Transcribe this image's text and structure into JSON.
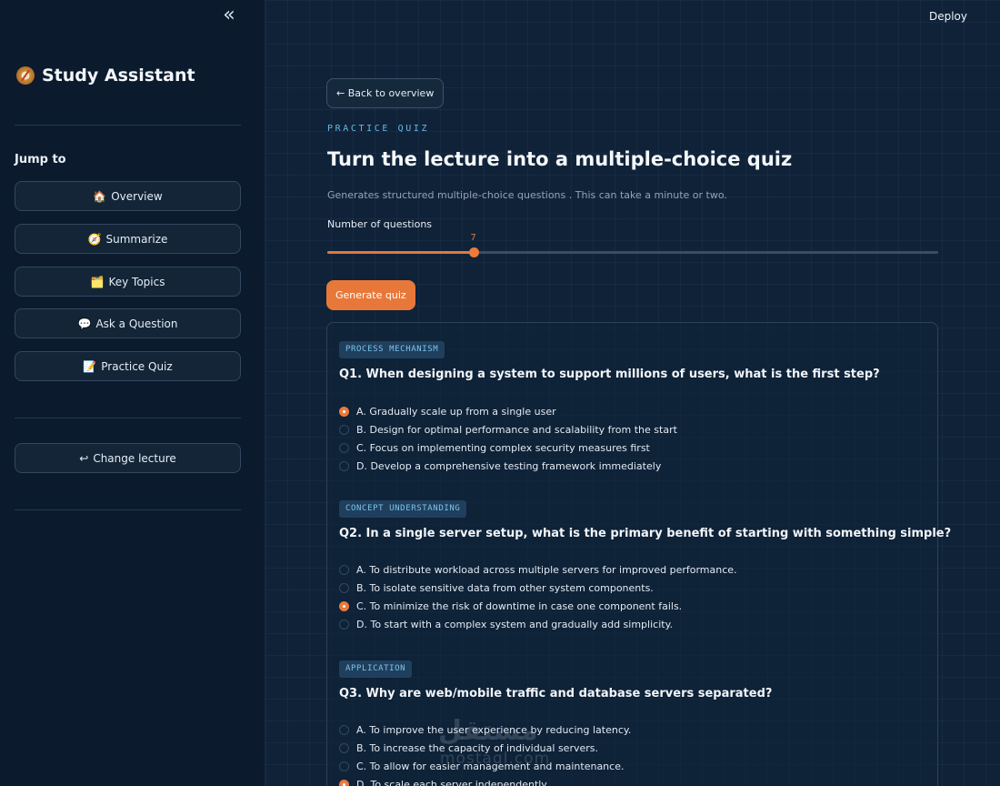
{
  "sidebar": {
    "title": "Study Assistant",
    "jump_label": "Jump to",
    "nav": [
      {
        "icon": "house-icon",
        "glyph": "🏠",
        "label": "Overview"
      },
      {
        "icon": "compass-icon",
        "glyph": "🧭",
        "label": "Summarize"
      },
      {
        "icon": "folder-icon",
        "glyph": "🗂️",
        "label": "Key Topics"
      },
      {
        "icon": "speech-bubble-icon",
        "glyph": "💬",
        "label": "Ask a Question"
      },
      {
        "icon": "memo-icon",
        "glyph": "📝",
        "label": "Practice Quiz"
      }
    ],
    "change_lecture": {
      "glyph": "↩",
      "label": "Change lecture"
    }
  },
  "header": {
    "deploy": "Deploy"
  },
  "main": {
    "back_label": "← Back to overview",
    "kicker": "PRACTICE QUIZ",
    "title": "Turn the lecture into a multiple-choice quiz",
    "subtitle": "Generates structured multiple-choice questions . This can take a minute or two.",
    "slider": {
      "label": "Number of questions",
      "value": 7,
      "fill_fraction": 0.239
    },
    "generate_label": "Generate quiz",
    "questions": [
      {
        "tag": "PROCESS MECHANISM",
        "text": "Q1. When designing a system to support millions of users, what is the first step?",
        "selected": 0,
        "options": [
          "A. Gradually scale up from a single user",
          "B. Design for optimal performance and scalability from the start",
          "C. Focus on implementing complex security measures first",
          "D. Develop a comprehensive testing framework immediately"
        ]
      },
      {
        "tag": "CONCEPT UNDERSTANDING",
        "text": "Q2. In a single server setup, what is the primary benefit of starting with something simple?",
        "selected": 2,
        "options": [
          "A. To distribute workload across multiple servers for improved performance.",
          "B. To isolate sensitive data from other system components.",
          "C. To minimize the risk of downtime in case one component fails.",
          "D. To start with a complex system and gradually add simplicity."
        ]
      },
      {
        "tag": "APPLICATION",
        "text": "Q3. Why are web/mobile traffic and database servers separated?",
        "selected": 3,
        "options": [
          "A. To improve the user experience by reducing latency.",
          "B. To increase the capacity of individual servers.",
          "C. To allow for easier management and maintenance.",
          "D. To scale each server independently"
        ]
      }
    ]
  },
  "watermark": {
    "text": "مستقل",
    "sub": "mostaql.com"
  },
  "colors": {
    "accent": "#ec7a3c",
    "badge_text": "#7cc3ec",
    "bg": "#0f2238",
    "sidebar_bg": "#0b1b2d"
  }
}
